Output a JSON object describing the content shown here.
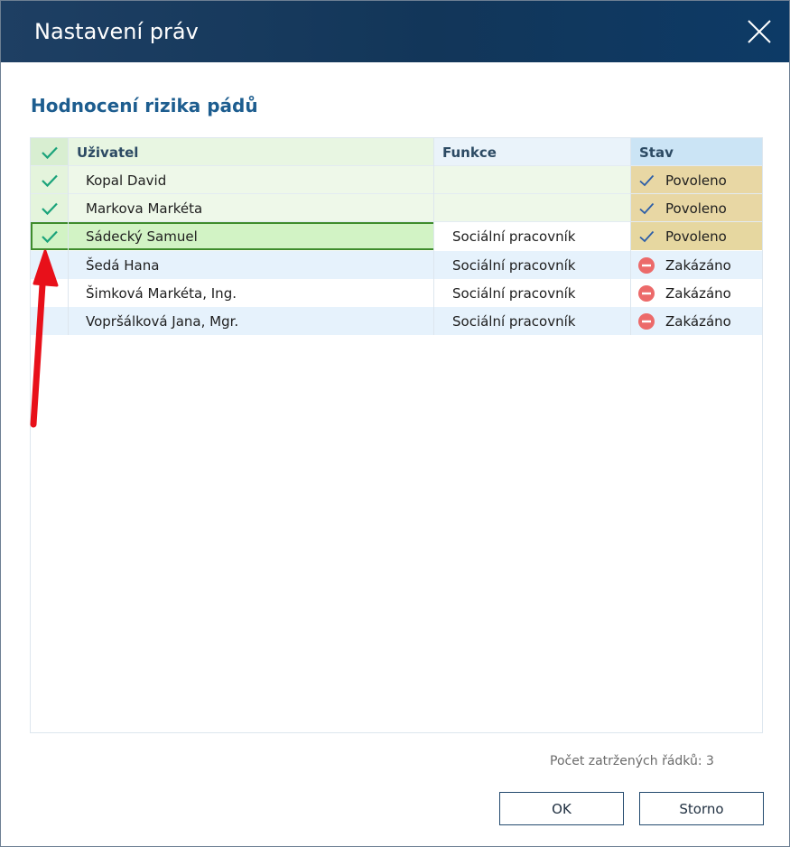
{
  "window": {
    "title": "Nastavení práv"
  },
  "section": {
    "title": "Hodnocení rizika pádů"
  },
  "table": {
    "columns": {
      "user": "Uživatel",
      "function": "Funkce",
      "status": "Stav"
    },
    "rows": [
      {
        "user": "Kopal David",
        "function": "",
        "status": "Povoleno",
        "checked": true
      },
      {
        "user": "Markova Markéta",
        "function": "",
        "status": "Povoleno",
        "checked": true
      },
      {
        "user": "Sádecký Samuel",
        "function": "Sociální pracovník",
        "status": "Povoleno",
        "checked": true,
        "selected": true
      },
      {
        "user": "Šedá Hana",
        "function": "Sociální pracovník",
        "status": "Zakázáno",
        "checked": false
      },
      {
        "user": "Šimková Markéta, Ing.",
        "function": "Sociální pracovník",
        "status": "Zakázáno",
        "checked": false
      },
      {
        "user": "Vopršálková Jana, Mgr.",
        "function": "Sociální pracovník",
        "status": "Zakázáno",
        "checked": false
      }
    ]
  },
  "footer": {
    "count_label": "Počet zatržených řádků: 3"
  },
  "buttons": {
    "ok": "OK",
    "cancel": "Storno"
  },
  "icons": {
    "header_check": "check-icon",
    "row_check": "check-icon",
    "allowed": "check-icon",
    "denied": "no-entry-icon",
    "close": "close-icon"
  },
  "colors": {
    "titlebar": "#123659",
    "section_title": "#1d5d8f",
    "check_green": "#1aa37a",
    "allowed_blue": "#2b5da8",
    "denied_red": "#ec6a6a",
    "selection_border": "#3e8c2c",
    "annotation_arrow": "#e8101a"
  }
}
